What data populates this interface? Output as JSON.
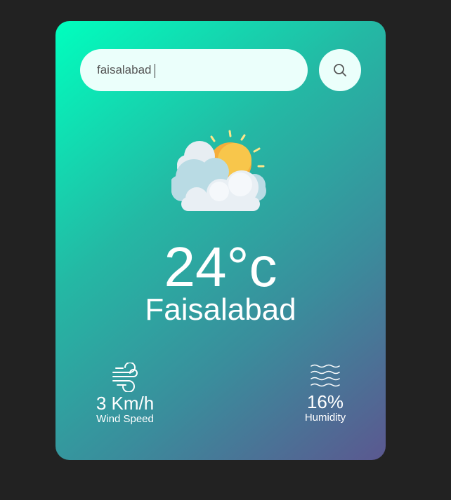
{
  "search": {
    "value": "faisalabad",
    "icon": "search-icon"
  },
  "weather": {
    "icon": "partly-cloudy-icon",
    "temperature": "24°c",
    "city": "Faisalabad"
  },
  "details": {
    "wind": {
      "icon": "wind-icon",
      "value": "3 Km/h",
      "label": "Wind Speed"
    },
    "humidity": {
      "icon": "humidity-icon",
      "value": "16%",
      "label": "Humidity"
    }
  },
  "colors": {
    "background": "#222222",
    "gradient_start": "#00ffbe",
    "gradient_end": "#5b5890",
    "input_bg": "#ebfffb",
    "text": "#ffffff"
  }
}
